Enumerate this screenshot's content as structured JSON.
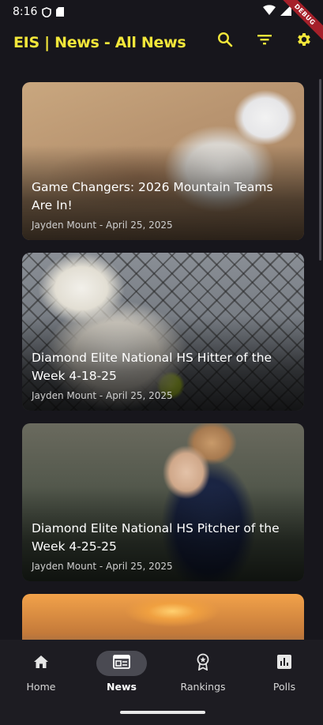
{
  "status_bar": {
    "time": "8:16",
    "debug_label": "DEBUG"
  },
  "app_bar": {
    "title": "EIS | News - All News",
    "accent_color": "#f2e63a",
    "actions": [
      "search-icon",
      "filter-icon",
      "gear-icon"
    ]
  },
  "articles": [
    {
      "title": "Game Changers: 2026 Mountain Teams Are In!",
      "meta": "Jayden Mount - April 25, 2025"
    },
    {
      "title": "Diamond Elite National HS Hitter of the Week 4-18-25",
      "meta": "Jayden Mount - April 25, 2025"
    },
    {
      "title": "Diamond Elite National HS Pitcher of the Week 4-25-25",
      "meta": "Jayden Mount - April 25, 2025"
    }
  ],
  "bottom_nav": {
    "items": [
      {
        "label": "Home",
        "icon": "home-icon",
        "active": false
      },
      {
        "label": "News",
        "icon": "news-icon",
        "active": true
      },
      {
        "label": "Rankings",
        "icon": "rankings-icon",
        "active": false
      },
      {
        "label": "Polls",
        "icon": "polls-icon",
        "active": false
      }
    ]
  }
}
